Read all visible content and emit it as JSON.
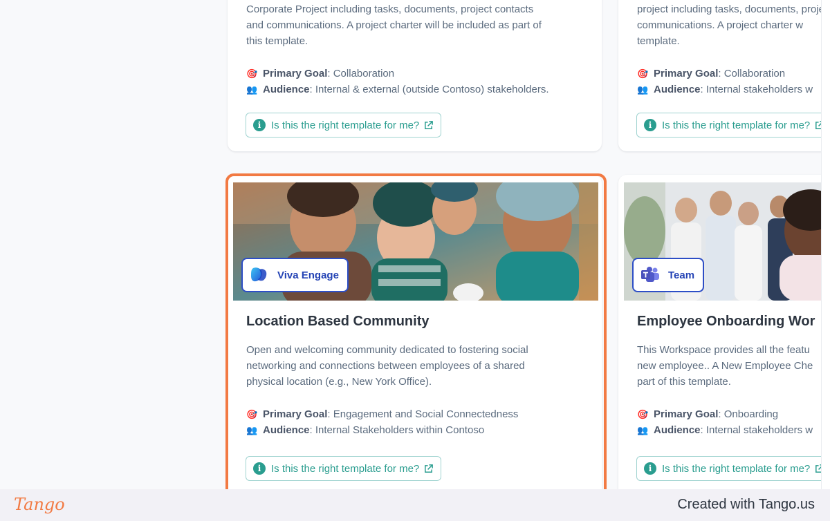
{
  "cards_top": [
    {
      "description_lines": [
        "Corporate Project including tasks, documents, project contacts",
        "and communications. A project charter will be included as part of",
        "this template."
      ],
      "goal_label": "Primary Goal",
      "goal_value": ": Collaboration",
      "audience_label": "Audience",
      "audience_value": ": Internal & external (outside Contoso) stakeholders.",
      "help_label": "Is this the right template for me?"
    },
    {
      "description_lines": [
        "project including tasks, documents, project",
        "communications. A project charter w",
        "template."
      ],
      "goal_label": "Primary Goal",
      "goal_value": ": Collaboration",
      "audience_label": "Audience",
      "audience_value": ": Internal stakeholders w",
      "help_label": "Is this the right template for me?"
    }
  ],
  "cards_bottom": [
    {
      "badge": "Viva Engage",
      "title": "Location Based Community",
      "description_lines": [
        "Open and welcoming community dedicated to fostering social",
        "networking and connections between employees of a shared",
        "physical location (e.g., New York Office)."
      ],
      "goal_label": "Primary Goal",
      "goal_value": ": Engagement and Social Connectedness",
      "audience_label": "Audience",
      "audience_value": ": Internal Stakeholders within Contoso",
      "help_label": "Is this the right template for me?"
    },
    {
      "badge": "Team",
      "title": "Employee Onboarding Wor",
      "description_lines": [
        "This Workspace provides all the featu",
        "new employee.. A New Employee Che",
        "part of this template."
      ],
      "goal_label": "Primary Goal",
      "goal_value": ": Onboarding",
      "audience_label": "Audience",
      "audience_value": ": Internal stakeholders w",
      "help_label": "Is this the right template for me?"
    }
  ],
  "footer": {
    "logo": "Tango",
    "credit": "Created with Tango.us"
  },
  "colors": {
    "highlight": "#f27a43",
    "accent_teal": "#2a9d8f",
    "badge_border": "#2d4ec6"
  }
}
